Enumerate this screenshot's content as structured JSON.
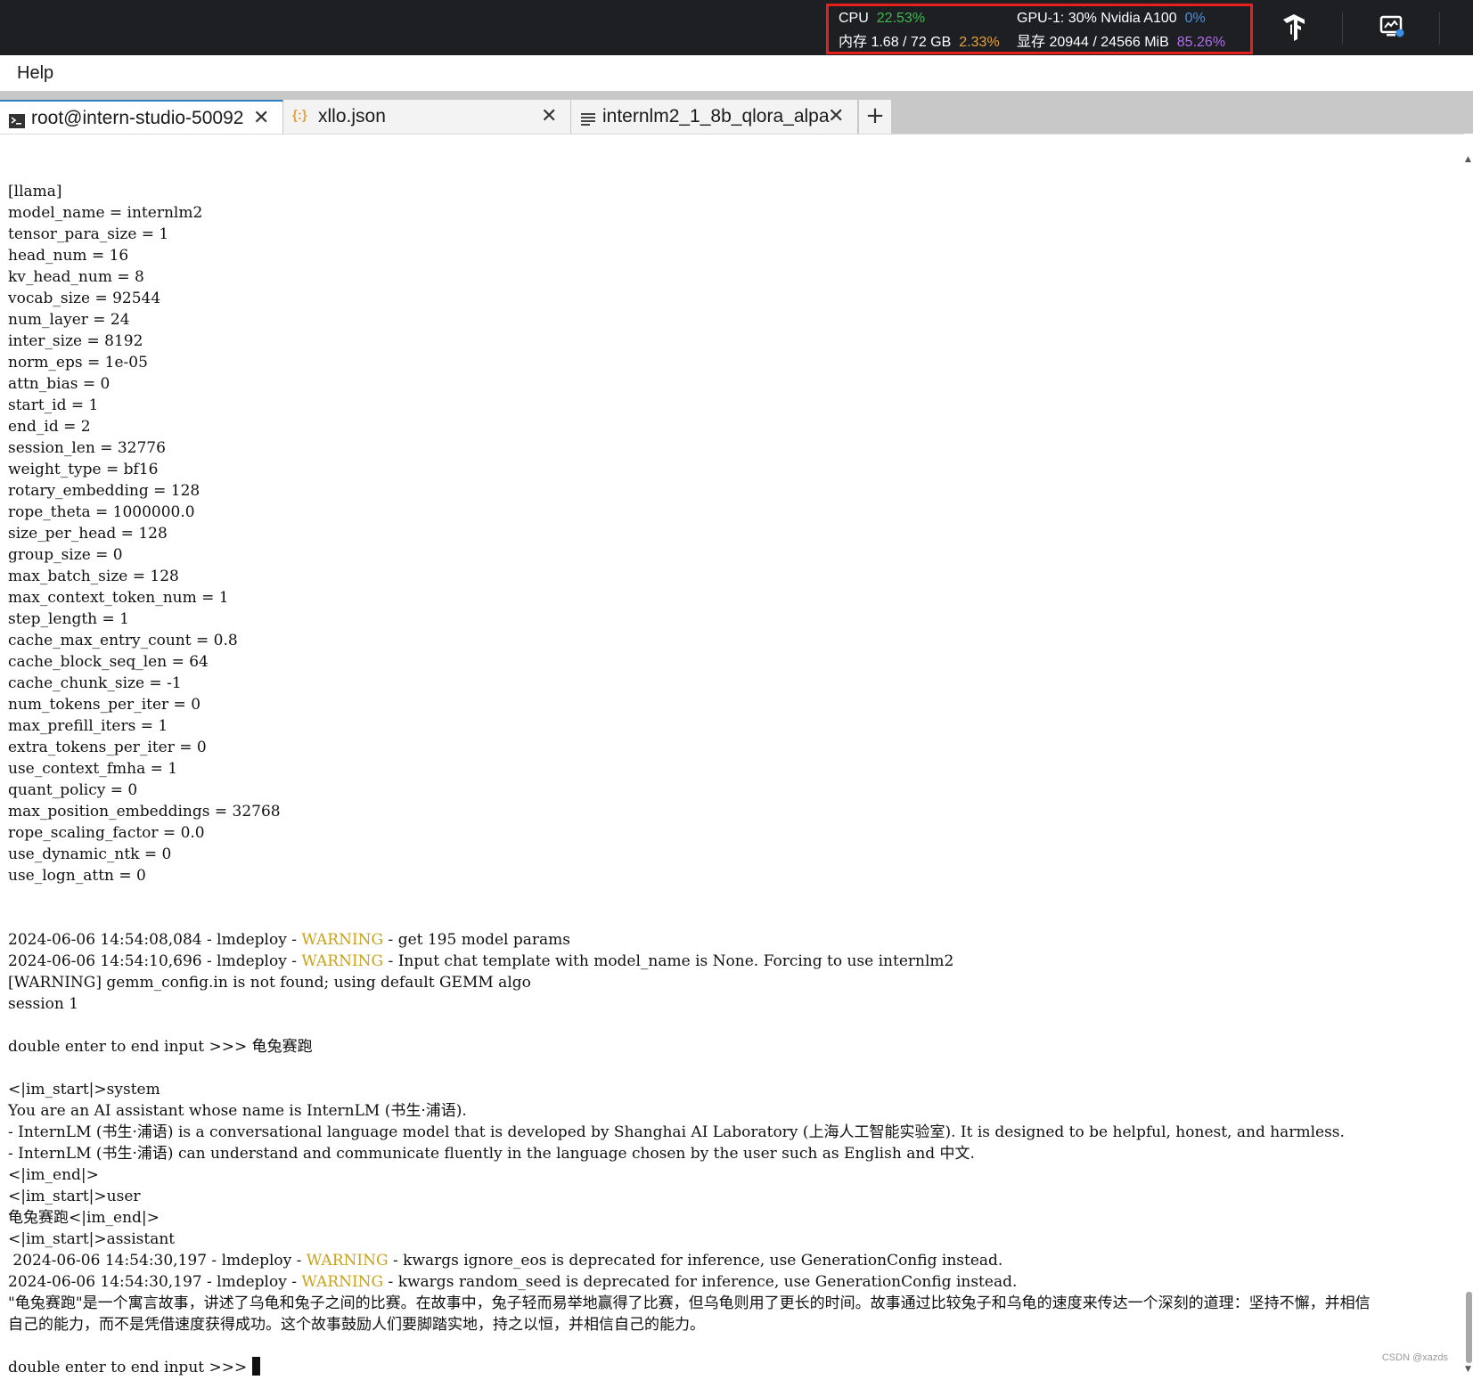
{
  "topbar": {
    "cpu_label": "CPU",
    "cpu_value": "22.53%",
    "mem_label": "内存 1.68 / 72 GB",
    "mem_value": "2.33%",
    "gpu_label": "GPU-1: 30% Nvidia A100",
    "gpu_value": "0%",
    "vram_label": "显存 20944 / 24566 MiB",
    "vram_value": "85.26%",
    "colors": {
      "cpu": "#3dbb4e",
      "mem": "#e6a23c",
      "gpu": "#4a90e2",
      "vram": "#b26cf0",
      "highlight_border": "#e5201d"
    },
    "icons": [
      "tensorflow-icon",
      "monitor-icon"
    ]
  },
  "menu": {
    "help": "Help"
  },
  "tabs": [
    {
      "label": "root@intern-studio-50092",
      "icon": "terminal-icon",
      "active": true
    },
    {
      "label": "xllo.json",
      "icon": "json-icon",
      "active": false
    },
    {
      "label": "internlm2_1_8b_qlora_alpa",
      "icon": "text-file-icon",
      "active": false
    }
  ],
  "add_tab": "+",
  "terminal": {
    "lines": [
      "[llama]",
      "model_name = internlm2",
      "tensor_para_size = 1",
      "head_num = 16",
      "kv_head_num = 8",
      "vocab_size = 92544",
      "num_layer = 24",
      "inter_size = 8192",
      "norm_eps = 1e-05",
      "attn_bias = 0",
      "start_id = 1",
      "end_id = 2",
      "session_len = 32776",
      "weight_type = bf16",
      "rotary_embedding = 128",
      "rope_theta = 1000000.0",
      "size_per_head = 128",
      "group_size = 0",
      "max_batch_size = 128",
      "max_context_token_num = 1",
      "step_length = 1",
      "cache_max_entry_count = 0.8",
      "cache_block_seq_len = 64",
      "cache_chunk_size = -1",
      "num_tokens_per_iter = 0",
      "max_prefill_iters = 1",
      "extra_tokens_per_iter = 0",
      "use_context_fmha = 1",
      "quant_policy = 0",
      "max_position_embeddings = 32768",
      "rope_scaling_factor = 0.0",
      "use_dynamic_ntk = 0",
      "use_logn_attn = 0",
      "",
      "",
      "2024-06-06 14:54:08,084 - lmdeploy - |WARNING| - get 195 model params",
      "2024-06-06 14:54:10,696 - lmdeploy - |WARNING| - Input chat template with model_name is None. Forcing to use internlm2",
      "[WARNING] gemm_config.in is not found; using default GEMM algo",
      "session 1",
      "",
      "double enter to end input >>> 龟兔赛跑",
      "",
      "<|im_start|>system",
      "You are an AI assistant whose name is InternLM (书生·浦语).",
      "- InternLM (书生·浦语) is a conversational language model that is developed by Shanghai AI Laboratory (上海人工智能实验室). It is designed to be helpful, honest, and harmless.",
      "- InternLM (书生·浦语) can understand and communicate fluently in the language chosen by the user such as English and 中文.",
      "<|im_end|>",
      "<|im_start|>user",
      "龟兔赛跑<|im_end|>",
      "<|im_start|>assistant",
      " 2024-06-06 14:54:30,197 - lmdeploy - |WARNING| - kwargs ignore_eos is deprecated for inference, use GenerationConfig instead.",
      "2024-06-06 14:54:30,197 - lmdeploy - |WARNING| - kwargs random_seed is deprecated for inference, use GenerationConfig instead.",
      "\"龟兔赛跑\"是一个寓言故事，讲述了乌龟和兔子之间的比赛。在故事中，兔子轻而易举地赢得了比赛，但乌龟则用了更长的时间。故事通过比较兔子和乌龟的速度来传达一个深刻的道理：坚持不懈，并相信",
      "自己的能力，而不是凭借速度获得成功。这个故事鼓励人们要脚踏实地，持之以恒，并相信自己的能力。",
      "",
      "double enter to end input >>> "
    ]
  },
  "watermark": "CSDN @xazds"
}
